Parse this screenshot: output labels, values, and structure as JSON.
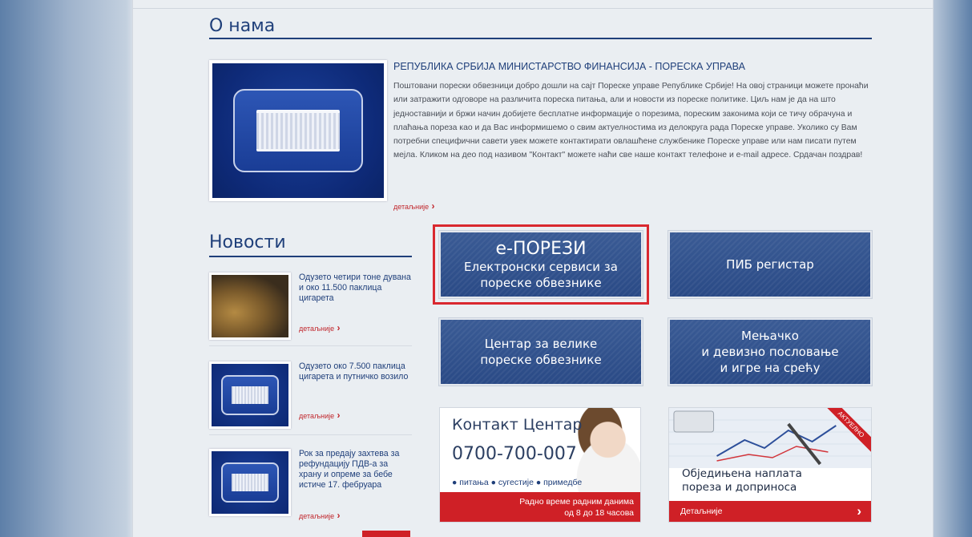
{
  "about": {
    "title": "О нама",
    "heading": "РЕПУБЛИКА СРБИЈА МИНИСТАРСТВО ФИНАНСИЈА - ПОРЕСКА УПРАВА",
    "text": "Поштовани порески обвезници добро дошли на сајт Пореске управе Републике Србије! На овој страници можете пронаћи или затражити одговоре на различита пореска питања, али и новости из пореске политике. Циљ нам је да на што једноставнији и бржи начин добијете бесплатне информације о порезима, пореским законима који се тичу обрачуна и плаћања пореза као и да Вас информишемо о свим актуелностима из делокруга рада Пореске управе. Уколико су Вам потребни специфични савети увек можете контактирати овлашћене службенике Пореске управе или нам писати путем мејла. Кликом на део под називом \"Контакт\" можете наћи све наше контакт телефоне и e-mail адресе. Срдачан поздрав!",
    "more": "детаљније"
  },
  "news": {
    "title": "Новости",
    "items": [
      {
        "text": "Одузето четири тоне дувана и око 11.500 паклица цигарета",
        "more": "детаљније"
      },
      {
        "text": "Одузето око 7.500 паклица цигарета и путничко возило",
        "more": "детаљније"
      },
      {
        "text": "Рок за предају захтева за рефундацију ПДВ-а за храну и опреме за бебе истиче 17. фебруара",
        "more": "детаљније"
      }
    ]
  },
  "tiles": {
    "eporezi_title": "е-ПОРЕЗИ",
    "eporezi_sub1": "Електронски сервиси за",
    "eporezi_sub2": "пореске обвезнике",
    "pib": "ПИБ регистар",
    "centar1": "Центар за велике",
    "centar2": "пореске обвезнике",
    "menjacko1": "Мењачко",
    "menjacko2": "и девизно пословање",
    "menjacko3": "и игре на срећу"
  },
  "contact": {
    "title": "Контакт Центар",
    "phone": "0700-700-007",
    "links": "● питања ● сугестије ● примедбе",
    "hours1": "Радно време радним данима",
    "hours2": "од 8 до 18 часова"
  },
  "promo": {
    "ribbon": "АКТУЕЛНО",
    "line1": "Обједињена наплата",
    "line2": "пореза и доприноса",
    "more": "Детаљније",
    "arrow": "›"
  },
  "colors": {
    "accent_red": "#cf2026",
    "navy": "#1f3f7a",
    "tile": "#2f4f8a"
  }
}
